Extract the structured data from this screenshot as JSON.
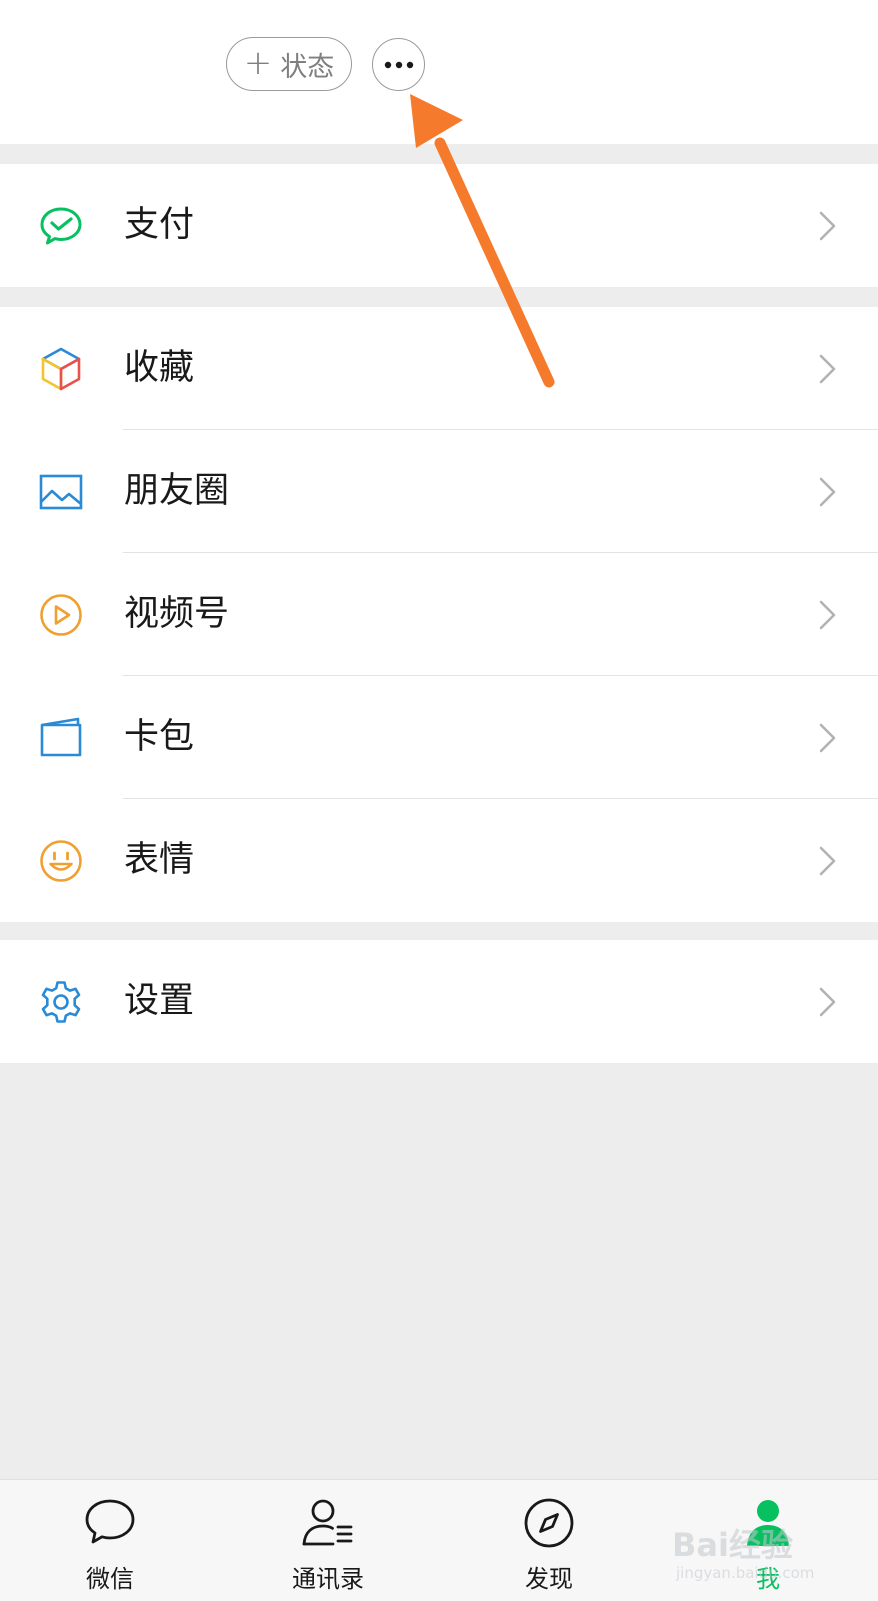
{
  "header": {
    "status_button_plus": "+",
    "status_button_label": "状态",
    "more_button_icon": "ellipsis-icon"
  },
  "menu": {
    "pay": {
      "label": "支付",
      "icon": "wechat-pay-icon",
      "color": "#07c160"
    },
    "favorites": {
      "label": "收藏",
      "icon": "cube-icon"
    },
    "moments": {
      "label": "朋友圈",
      "icon": "picture-icon",
      "color": "#2a8ad6"
    },
    "channels": {
      "label": "视频号",
      "icon": "play-circle-icon",
      "color": "#f0a030"
    },
    "cards": {
      "label": "卡包",
      "icon": "card-wallet-icon",
      "color": "#2a8ad6"
    },
    "stickers": {
      "label": "表情",
      "icon": "smiley-icon",
      "color": "#f0a030"
    },
    "settings": {
      "label": "设置",
      "icon": "gear-icon",
      "color": "#2a8ad6"
    }
  },
  "tabbar": {
    "tabs": [
      {
        "label": "微信",
        "icon": "chat-bubble-icon",
        "active": false
      },
      {
        "label": "通讯录",
        "icon": "contacts-icon",
        "active": false
      },
      {
        "label": "发现",
        "icon": "compass-icon",
        "active": false
      },
      {
        "label": "我",
        "icon": "person-icon",
        "active": true
      }
    ],
    "active_color": "#07c160"
  },
  "overlay": {
    "arrow_color": "#f57a2c"
  },
  "watermark": {
    "brand": "Bai经验",
    "sub": "jingyan.baidu.com"
  }
}
